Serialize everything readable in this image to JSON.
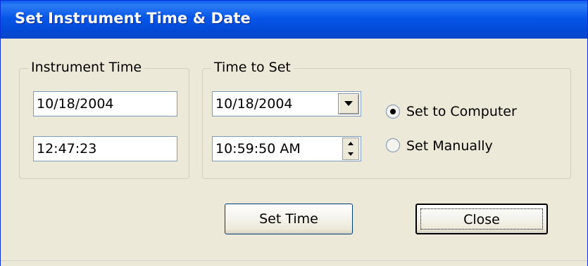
{
  "window": {
    "title": "Set Instrument Time & Date"
  },
  "instrument_time": {
    "group_label": "Instrument Time",
    "date_value": "10/18/2004",
    "time_value": "12:47:23"
  },
  "time_to_set": {
    "group_label": "Time to Set",
    "date_value": "10/18/2004",
    "time_value": "10:59:50 AM",
    "radio_options": [
      {
        "label": "Set to Computer",
        "selected": true
      },
      {
        "label": "Set Manually",
        "selected": false
      }
    ]
  },
  "buttons": {
    "set_time_label": "Set Time",
    "close_label": "Close"
  },
  "colors": {
    "titlebar": "#0756e8",
    "face": "#ece9d8",
    "input_border": "#7f9db9"
  },
  "icons": {
    "dropdown": "chevron-down-icon",
    "spin_up": "spin-up-icon",
    "spin_down": "spin-down-icon"
  }
}
